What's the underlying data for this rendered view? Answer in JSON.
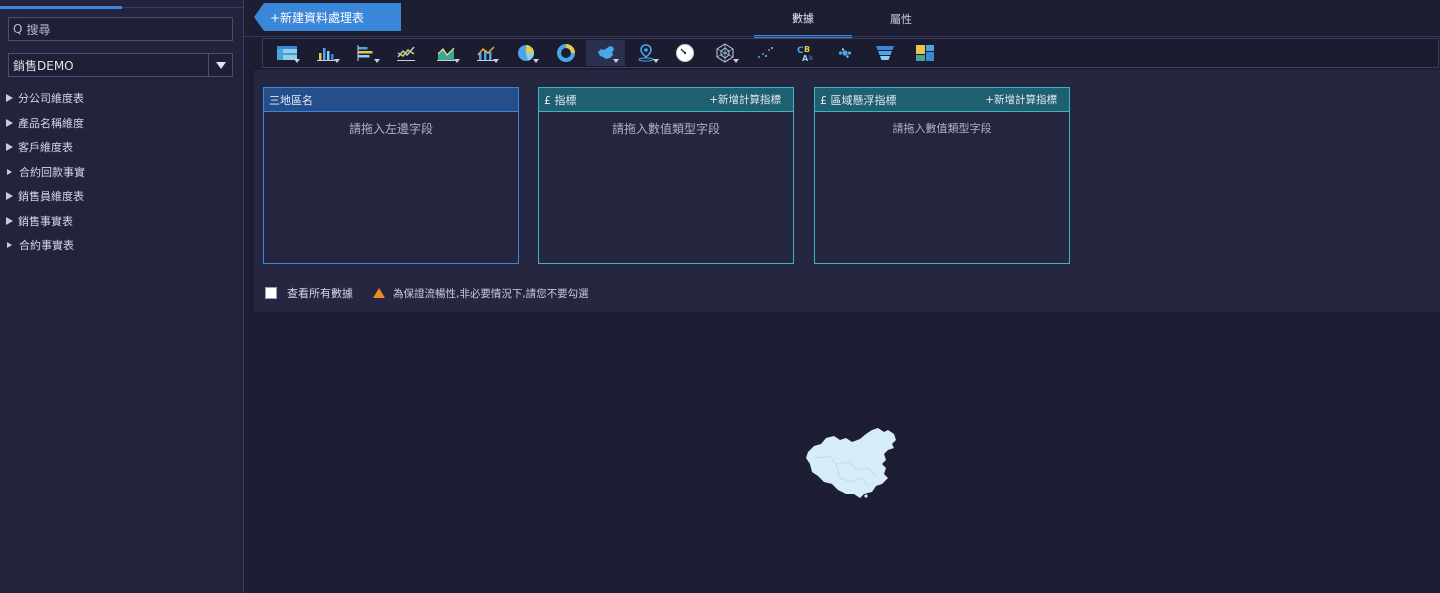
{
  "sidebar": {
    "search_placeholder": "搜尋",
    "search_icon_glyph": "Q",
    "dataset": "銷售DEMO",
    "items": [
      {
        "label": "分公司維度表"
      },
      {
        "label": "產品名稱維度"
      },
      {
        "label": "客戶維度表"
      },
      {
        "label": "合約回款事實"
      },
      {
        "label": "銷售員維度表"
      },
      {
        "label": "銷售事實表"
      },
      {
        "label": "合約事實表"
      }
    ]
  },
  "header": {
    "new_table_button": "+新建資料處理表",
    "tabs": [
      {
        "label": "數據",
        "active": true
      },
      {
        "label": "屬性",
        "active": false
      }
    ]
  },
  "toolbar": {
    "tools": [
      {
        "icon": "table-icon",
        "dropdown": true
      },
      {
        "icon": "bar-chart-icon",
        "dropdown": true
      },
      {
        "icon": "horizontal-bar-chart-icon",
        "dropdown": true
      },
      {
        "icon": "line-chart-icon",
        "dropdown": false
      },
      {
        "icon": "area-chart-icon",
        "dropdown": true
      },
      {
        "icon": "combo-chart-icon",
        "dropdown": true
      },
      {
        "icon": "pie-chart-icon",
        "dropdown": true
      },
      {
        "icon": "donut-chart-icon",
        "dropdown": false
      },
      {
        "icon": "china-map-icon",
        "dropdown": true,
        "active": true
      },
      {
        "icon": "location-pin-icon",
        "dropdown": true
      },
      {
        "icon": "gauge-icon",
        "dropdown": false
      },
      {
        "icon": "radar-chart-icon",
        "dropdown": true
      },
      {
        "icon": "scatter-icon",
        "dropdown": false
      },
      {
        "icon": "word-cloud-icon",
        "dropdown": false
      },
      {
        "icon": "bubble-icon",
        "dropdown": false
      },
      {
        "icon": "funnel-icon",
        "dropdown": false
      },
      {
        "icon": "treemap-icon",
        "dropdown": false
      }
    ]
  },
  "panels": {
    "region": {
      "title": "三地區名",
      "hint": "請拖入左邊字段"
    },
    "metric": {
      "title": "£ 指標",
      "add_label": "+新增計算指標",
      "hint": "請拖入數值類型字段"
    },
    "hover_metric": {
      "title": "£ 區域懸浮指標",
      "add_label": "+新增計算指標",
      "hint": "請拖入數值類型字段"
    }
  },
  "options": {
    "view_all_label": "查看所有數據",
    "view_all_checked": false,
    "warning_text": "為保證流暢性,非必要情況下,請您不要勾選"
  },
  "colors": {
    "accent": "#3a86d8",
    "teal": "#3fb2c8",
    "warning": "#f08a24",
    "map_fill": "#d6ecf7"
  }
}
